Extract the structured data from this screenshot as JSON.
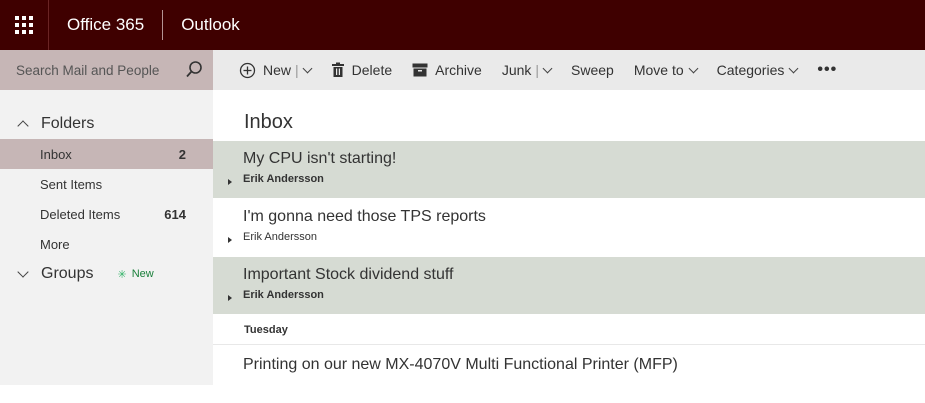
{
  "header": {
    "brand": "Office 365",
    "app": "Outlook"
  },
  "search": {
    "placeholder": "Search Mail and People"
  },
  "toolbar": {
    "new_label": "New",
    "delete_label": "Delete",
    "archive_label": "Archive",
    "junk_label": "Junk",
    "sweep_label": "Sweep",
    "move_label": "Move to",
    "categories_label": "Categories",
    "more_label": "•••"
  },
  "sidebar": {
    "folders_label": "Folders",
    "items": [
      {
        "label": "Inbox",
        "count": "2"
      },
      {
        "label": "Sent Items",
        "count": ""
      },
      {
        "label": "Deleted Items",
        "count": "614"
      },
      {
        "label": "More",
        "count": ""
      }
    ],
    "groups_label": "Groups",
    "groups_badge": "New"
  },
  "main": {
    "title": "Inbox",
    "messages": [
      {
        "subject": "My CPU isn't starting!",
        "sender": "Erik Andersson",
        "unread": true
      },
      {
        "subject": "I'm gonna need those TPS reports",
        "sender": "Erik Andersson",
        "unread": false
      },
      {
        "subject": "Important Stock dividend stuff",
        "sender": "Erik Andersson",
        "unread": true
      }
    ],
    "group_header": "Tuesday",
    "last_message": {
      "subject": "Printing on our new MX-4070V Multi Functional Printer (MFP)"
    }
  },
  "colors": {
    "topbar": "#3f0000",
    "selected": "#c6b6b6",
    "unread_row": "#d6dbd3"
  }
}
